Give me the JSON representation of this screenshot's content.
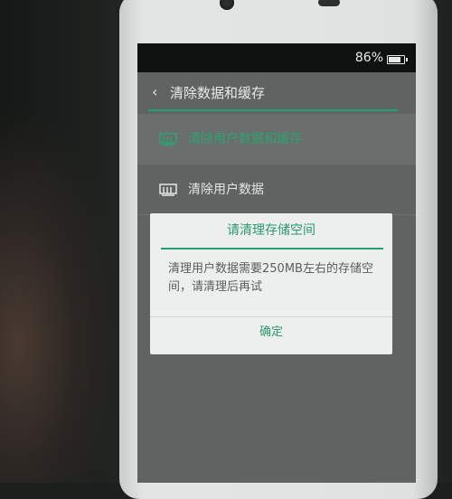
{
  "status_bar": {
    "battery_percent": "86%",
    "battery_level": 0.86
  },
  "header": {
    "back_icon": "chevron-left-icon",
    "title": "清除数据和缓存"
  },
  "menu": {
    "items": [
      {
        "label": "清除用户数据和缓存",
        "icon": "storage-clean-icon",
        "color": "#2ba36f"
      },
      {
        "label": "清除用户数据",
        "icon": "storage-clean-icon",
        "color": "#e3e6e4"
      }
    ]
  },
  "dialog": {
    "title": "请清理存储空间",
    "message": "清理用户数据需要250MB左右的存储空间，请清理后再试",
    "confirm_label": "确定"
  },
  "colors": {
    "accent": "#22a070",
    "dialog_bg": "#ecefee"
  }
}
